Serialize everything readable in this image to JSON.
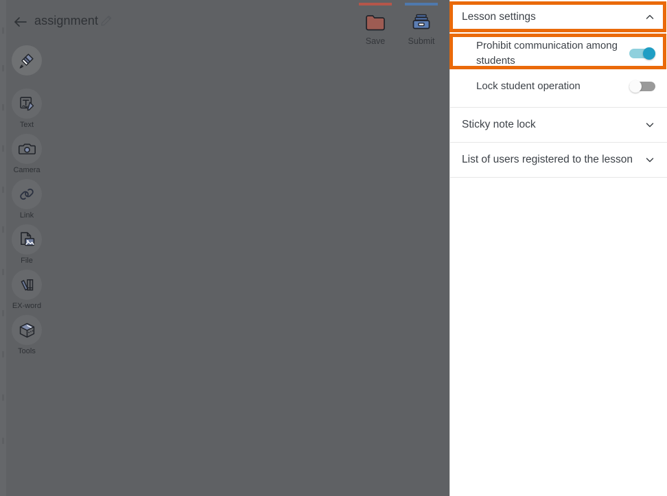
{
  "editor": {
    "back_icon": "back-arrow-icon",
    "title": "assignment",
    "edit_icon": "pencil-icon",
    "actions": [
      {
        "id": "save",
        "label": "Save",
        "icon": "folder-icon",
        "bar_color": "#b5564a"
      },
      {
        "id": "submit",
        "label": "Submit",
        "icon": "tray-icon",
        "bar_color": "#4f79ad"
      }
    ],
    "tools": [
      {
        "id": "marker",
        "label": "",
        "icon": "marker-pen-icon",
        "active": true
      },
      {
        "id": "text",
        "label": "Text",
        "icon": "text-note-icon",
        "active": false
      },
      {
        "id": "camera",
        "label": "Camera",
        "icon": "camera-icon",
        "active": false
      },
      {
        "id": "link",
        "label": "Link",
        "icon": "link-chain-icon",
        "active": false
      },
      {
        "id": "file",
        "label": "File",
        "icon": "file-image-icon",
        "active": false
      },
      {
        "id": "exword",
        "label": "EX-word",
        "icon": "books-icon",
        "active": false
      },
      {
        "id": "tools",
        "label": "Tools",
        "icon": "toolbox-cube-icon",
        "active": false
      }
    ]
  },
  "panel": {
    "lesson_settings": {
      "title": "Lesson settings",
      "chevron": "chevron-up-icon",
      "expanded": true,
      "rows": [
        {
          "label": "Prohibit communication among students",
          "state": "on",
          "toggle_name": "prohibit-communication-toggle"
        },
        {
          "label": "Lock student operation",
          "state": "off",
          "toggle_name": "lock-student-operation-toggle"
        }
      ]
    },
    "sections": [
      {
        "title": "Sticky note lock",
        "chevron": "chevron-down-icon"
      },
      {
        "title": "List of users registered to the lesson",
        "chevron": "chevron-down-icon"
      }
    ]
  },
  "annotations": {
    "color": "#ea6a0a",
    "boxes": [
      {
        "id": "hl-header",
        "target": "lesson-settings-header"
      },
      {
        "id": "hl-row",
        "target": "prohibit-communication-row"
      }
    ]
  },
  "colors": {
    "canvas_dim": "#5f6164",
    "panel_bg": "#ffffff",
    "toggle_on": "#1f9ec4",
    "toggle_on_track": "#8fd0dd",
    "toggle_off_track": "#9a9a9a",
    "highlight": "#ea6a0a",
    "save_bar": "#b5564a",
    "submit_bar": "#4f79ad"
  }
}
